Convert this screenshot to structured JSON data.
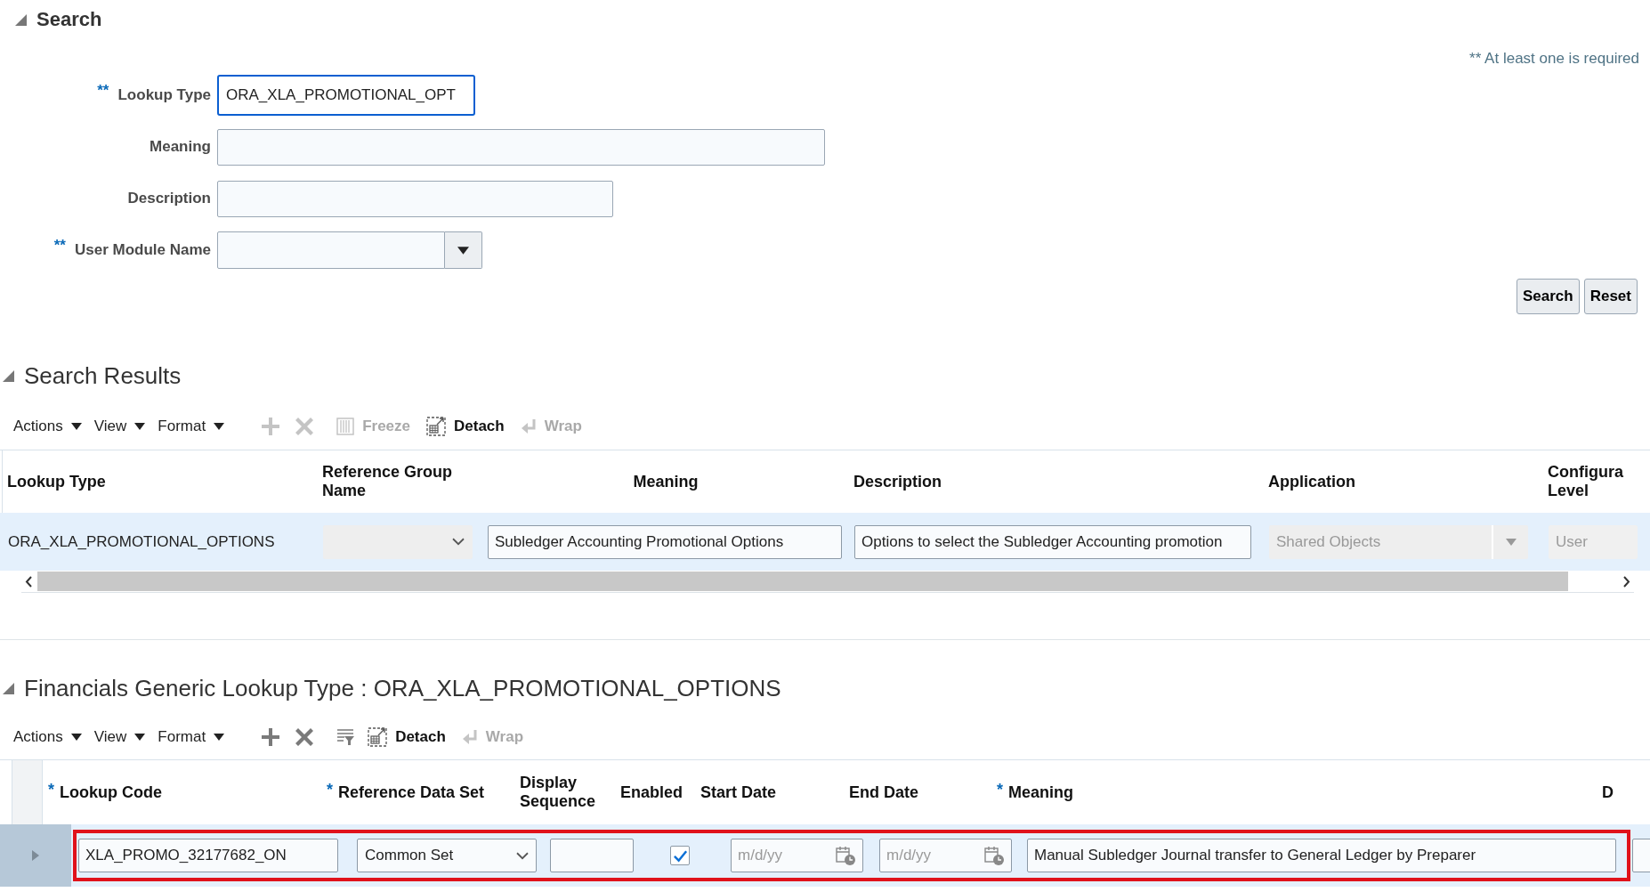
{
  "search": {
    "title": "Search",
    "expanded": true,
    "required_note": "** At least one is required",
    "fields": [
      {
        "kind": "text",
        "label": "Lookup Type",
        "required_mark": "**",
        "value": "ORA_XLA_PROMOTIONAL_OPT",
        "focused": true
      },
      {
        "kind": "text",
        "label": "Meaning",
        "focused": false
      },
      {
        "kind": "text",
        "label": "Description",
        "focused": false
      },
      {
        "kind": "combo",
        "label": "User Module Name",
        "required_mark": "**",
        "focused": false
      }
    ],
    "buttons": [
      "Search",
      "Reset"
    ]
  },
  "search_results": {
    "title": "Search Results",
    "expanded": true,
    "toolbar": [
      {
        "kind": "menu",
        "label": "Actions"
      },
      {
        "kind": "menu",
        "label": "View"
      },
      {
        "kind": "menu",
        "label": "Format"
      },
      {
        "kind": "add",
        "disabled": true
      },
      {
        "kind": "delete",
        "disabled": true
      },
      {
        "kind": "freeze",
        "label": "Freeze",
        "disabled": true
      },
      {
        "kind": "detach",
        "label": "Detach",
        "disabled": false
      },
      {
        "kind": "wrap",
        "label": "Wrap",
        "disabled": true
      }
    ],
    "columns": [
      {
        "label": "Lookup Type"
      },
      {
        "label": "Reference Group Name"
      },
      {
        "label": "Meaning"
      },
      {
        "label": "Description"
      },
      {
        "label": "Application"
      },
      {
        "label": "Configura Level"
      }
    ],
    "rows": [
      {
        "selected": true,
        "cells": [
          {
            "kind": "text",
            "value": "ORA_XLA_PROMOTIONAL_OPTIONS"
          },
          {
            "kind": "select",
            "disabled": true
          },
          {
            "kind": "input",
            "value": "Subledger Accounting Promotional Options",
            "disabled": false
          },
          {
            "kind": "input",
            "value": "Options to select the Subledger Accounting promotion",
            "disabled": false
          },
          {
            "kind": "combo",
            "value": "Shared Objects",
            "disabled": true
          },
          {
            "kind": "input",
            "value": "User",
            "disabled": true
          }
        ]
      }
    ]
  },
  "lookup_codes": {
    "title": "Financials Generic Lookup Type : ORA_XLA_PROMOTIONAL_OPTIONS",
    "expanded": true,
    "toolbar": [
      {
        "kind": "menu",
        "label": "Actions"
      },
      {
        "kind": "menu",
        "label": "View"
      },
      {
        "kind": "menu",
        "label": "Format"
      },
      {
        "kind": "add",
        "disabled": false
      },
      {
        "kind": "delete",
        "disabled": false
      },
      {
        "kind": "query",
        "disabled": false
      },
      {
        "kind": "detach",
        "label": "Detach",
        "disabled": false
      },
      {
        "kind": "wrap",
        "label": "Wrap",
        "disabled": true
      }
    ],
    "columns": [
      {
        "label": "Lookup Code",
        "required_mark": "*"
      },
      {
        "label": "Reference Data Set",
        "required_mark": "*"
      },
      {
        "label": "Display Sequence"
      },
      {
        "label": "Enabled"
      },
      {
        "label": "Start Date"
      },
      {
        "label": "End Date"
      },
      {
        "label": "Meaning",
        "required_mark": "*"
      },
      {
        "label": "D"
      }
    ],
    "rows": [
      {
        "selected": true,
        "highlighted": true,
        "cells": [
          {
            "kind": "input",
            "value": "XLA_PROMO_32177682_ON",
            "disabled": false
          },
          {
            "kind": "select",
            "value": "Common Set",
            "disabled": false
          },
          {
            "kind": "input",
            "disabled": false
          },
          {
            "kind": "checkbox",
            "checked": true
          },
          {
            "kind": "date",
            "placeholder": "m/d/yy"
          },
          {
            "kind": "date",
            "placeholder": "m/d/yy"
          },
          {
            "kind": "input",
            "value": "Manual Subledger Journal transfer to General Ledger by Preparer",
            "disabled": false
          },
          {
            "kind": "input",
            "disabled": false
          }
        ]
      }
    ]
  }
}
